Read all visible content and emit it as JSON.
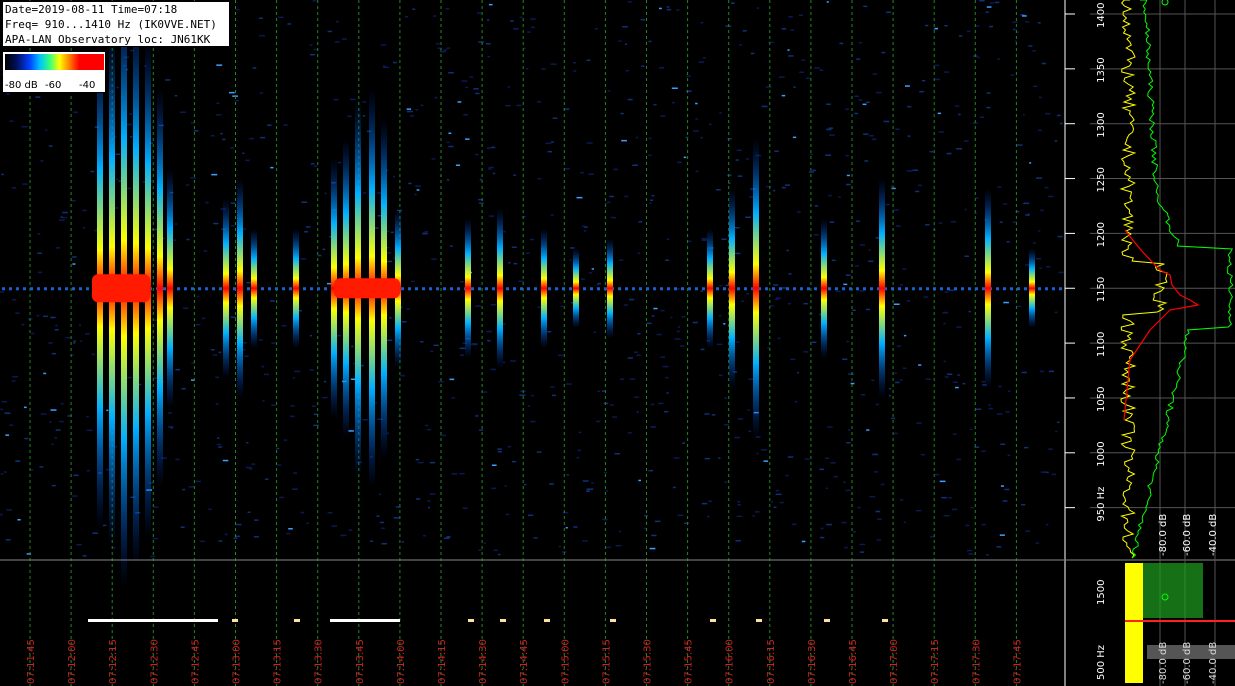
{
  "header": {
    "line1": "Date=2019-08-11 Time=07:18",
    "line2": "Freq= 910...1410 Hz (IK0VVE.NET)",
    "line3": "APA-LAN Observatory loc: JN61KK"
  },
  "colorscale": {
    "label_a": "-80 dB",
    "label_b": "-60",
    "label_c": "-40"
  },
  "chart_data": {
    "type": "heatmap",
    "title": "",
    "x_ticks": [
      "07:11:45",
      "07:12:00",
      "07:12:15",
      "07:12:30",
      "07:12:45",
      "07:13:00",
      "07:13:15",
      "07:13:30",
      "07:13:45",
      "07:14:00",
      "07:14:15",
      "07:14:30",
      "07:14:45",
      "07:15:00",
      "07:15:15",
      "07:15:30",
      "07:15:45",
      "07:16:00",
      "07:16:15",
      "07:16:30",
      "07:16:45",
      "07:17:00",
      "07:17:15",
      "07:17:30",
      "07:17:45"
    ],
    "y_ticks_main": [
      "1400",
      "1350",
      "1300",
      "1250",
      "1200",
      "1150",
      "1100",
      "1050",
      "1000",
      "950 Hz"
    ],
    "y_ticks_lower": [
      "1500",
      "500 Hz"
    ],
    "spectrum_db_labels": [
      "-80.0 dB",
      "-60.0 dB",
      "-40.0 dB"
    ],
    "spectrum_db_labels_lower": [
      "-80.0 dB",
      "-60.0 dB",
      "-40.0 dB"
    ],
    "colors": {
      "grid": "#1f8a1f",
      "tick_text": "#cc2222",
      "spectrum_avg": "#ffff00",
      "spectrum_peak": "#00ff00",
      "spectrum_curve": "#ff0000"
    }
  }
}
